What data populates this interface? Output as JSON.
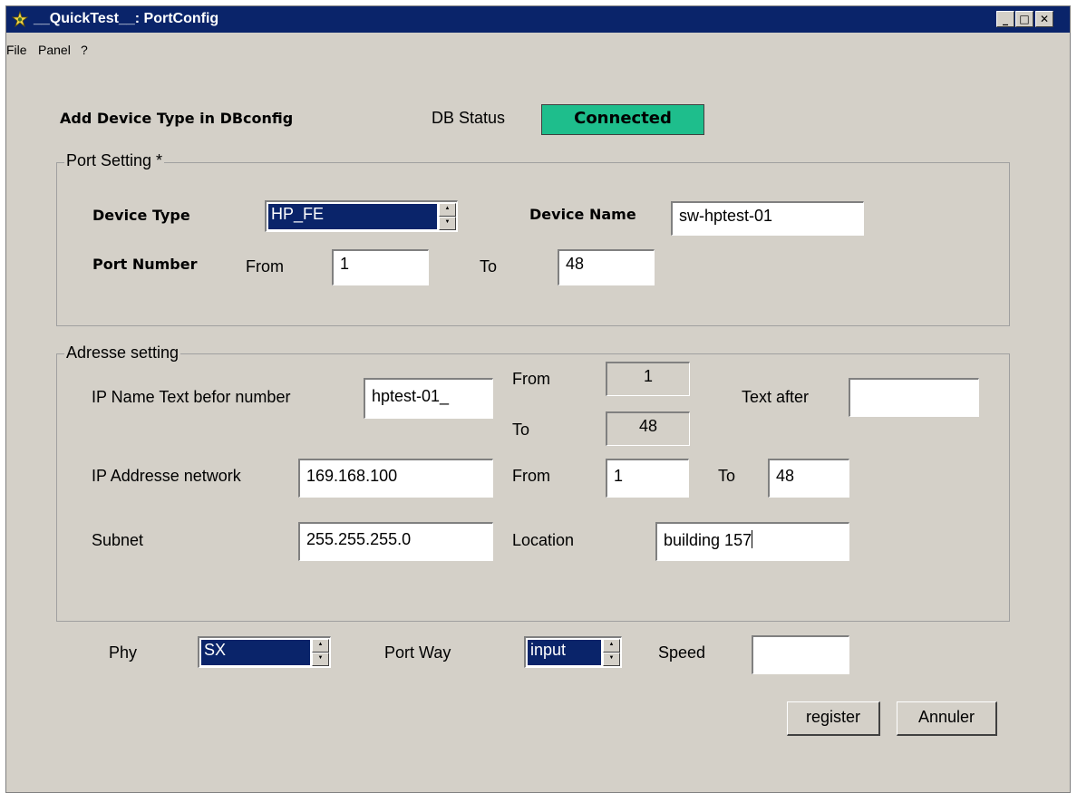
{
  "window": {
    "title": "__QuickTest__: PortConfig",
    "controls": {
      "minimize": "_",
      "maximize": "□",
      "close": "✕"
    }
  },
  "menu": [
    "File",
    "Panel",
    "?"
  ],
  "header": {
    "heading": "Add Device Type in DBconfig",
    "db_status_label": "DB Status",
    "db_status_value": "Connected",
    "db_status_color": "#1ebe8c"
  },
  "port_setting": {
    "title": "Port Setting *",
    "device_type_label": "Device Type",
    "device_type_value": "HP_FE",
    "device_name_label": "Device Name",
    "device_name_value": "sw-hptest-01",
    "port_number_label": "Port Number",
    "from_label": "From",
    "from_value": "1",
    "to_label": "To",
    "to_value": "48"
  },
  "address_setting": {
    "title": "Adresse setting",
    "ip_name_label": "IP Name Text befor number",
    "ip_name_value": "hptest-01_",
    "from_label": "From",
    "from_value": "1",
    "to_label": "To",
    "to_value": "48",
    "text_after_label": "Text after",
    "text_after_value": "",
    "ip_network_label": "IP Addresse network",
    "ip_network_value": "169.168.100",
    "ip_from_label": "From",
    "ip_from_value": "1",
    "ip_to_label": "To",
    "ip_to_value": "48",
    "subnet_label": "Subnet",
    "subnet_value": "255.255.255.0",
    "location_label": "Location",
    "location_value": "building 157"
  },
  "bottom": {
    "phy_label": "Phy",
    "phy_value": "SX",
    "port_way_label": "Port Way",
    "port_way_value": "input",
    "speed_label": "Speed",
    "speed_value": ""
  },
  "buttons": {
    "register": "register",
    "cancel": "Annuler"
  }
}
